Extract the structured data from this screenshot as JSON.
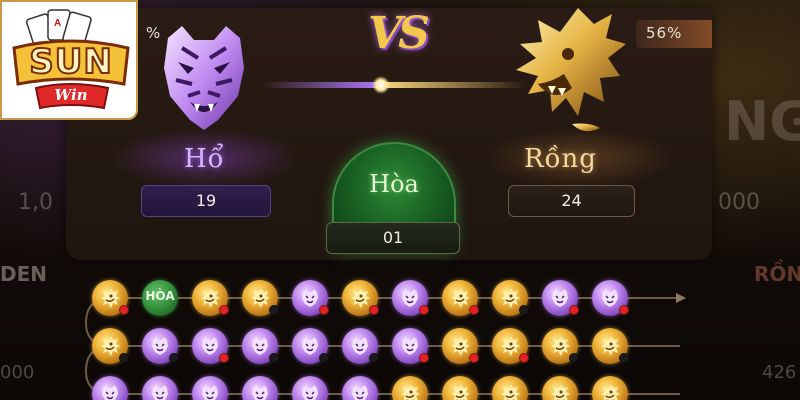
{
  "logo": {
    "brand": "SUN",
    "sub": "Win"
  },
  "top": {
    "left_percent": "%",
    "right_percent": "56%",
    "vs_text": "VS"
  },
  "tiger": {
    "label": "Hổ",
    "count": "19"
  },
  "dragon": {
    "label": "Rồng",
    "count": "24"
  },
  "tie": {
    "label": "Hòa",
    "count": "01"
  },
  "background": {
    "left_number": "1,0",
    "left_label": "DEN",
    "left_bottom": "000",
    "right_number": "000",
    "right_partial": "NG",
    "right_label": "RỒN",
    "right_bottom": "426"
  },
  "roadmap": {
    "tie_chip_label": "HÒA",
    "rows": [
      [
        {
          "t": "dragon",
          "d": "red"
        },
        {
          "t": "tie",
          "d": ""
        },
        {
          "t": "dragon",
          "d": "red"
        },
        {
          "t": "dragon",
          "d": "black"
        },
        {
          "t": "tiger",
          "d": "red"
        },
        {
          "t": "dragon",
          "d": "red"
        },
        {
          "t": "tiger",
          "d": "red"
        },
        {
          "t": "dragon",
          "d": "red"
        },
        {
          "t": "dragon",
          "d": "black"
        },
        {
          "t": "tiger",
          "d": "red"
        },
        {
          "t": "tiger",
          "d": "red"
        }
      ],
      [
        {
          "t": "dragon",
          "d": "black"
        },
        {
          "t": "tiger",
          "d": "black"
        },
        {
          "t": "tiger",
          "d": "red"
        },
        {
          "t": "tiger",
          "d": "black"
        },
        {
          "t": "tiger",
          "d": "black"
        },
        {
          "t": "tiger",
          "d": "black"
        },
        {
          "t": "tiger",
          "d": "red"
        },
        {
          "t": "dragon",
          "d": "red"
        },
        {
          "t": "dragon",
          "d": "red"
        },
        {
          "t": "dragon",
          "d": "black"
        },
        {
          "t": "dragon",
          "d": "black"
        }
      ],
      [
        {
          "t": "tiger",
          "d": "red"
        },
        {
          "t": "tiger",
          "d": "red"
        },
        {
          "t": "tiger",
          "d": "red"
        },
        {
          "t": "tiger",
          "d": "black"
        },
        {
          "t": "tiger",
          "d": "black"
        },
        {
          "t": "tiger",
          "d": "black"
        },
        {
          "t": "dragon",
          "d": "red"
        },
        {
          "t": "dragon",
          "d": "red"
        },
        {
          "t": "dragon",
          "d": "red"
        },
        {
          "t": "dragon",
          "d": "red"
        },
        {
          "t": "dragon",
          "d": "red"
        }
      ]
    ]
  },
  "colors": {
    "tiger": "#8a4fc6",
    "dragon": "#f0b53a",
    "tie": "#2f8a36",
    "red_dot": "#e02222",
    "black_dot": "#1a1a1a"
  }
}
